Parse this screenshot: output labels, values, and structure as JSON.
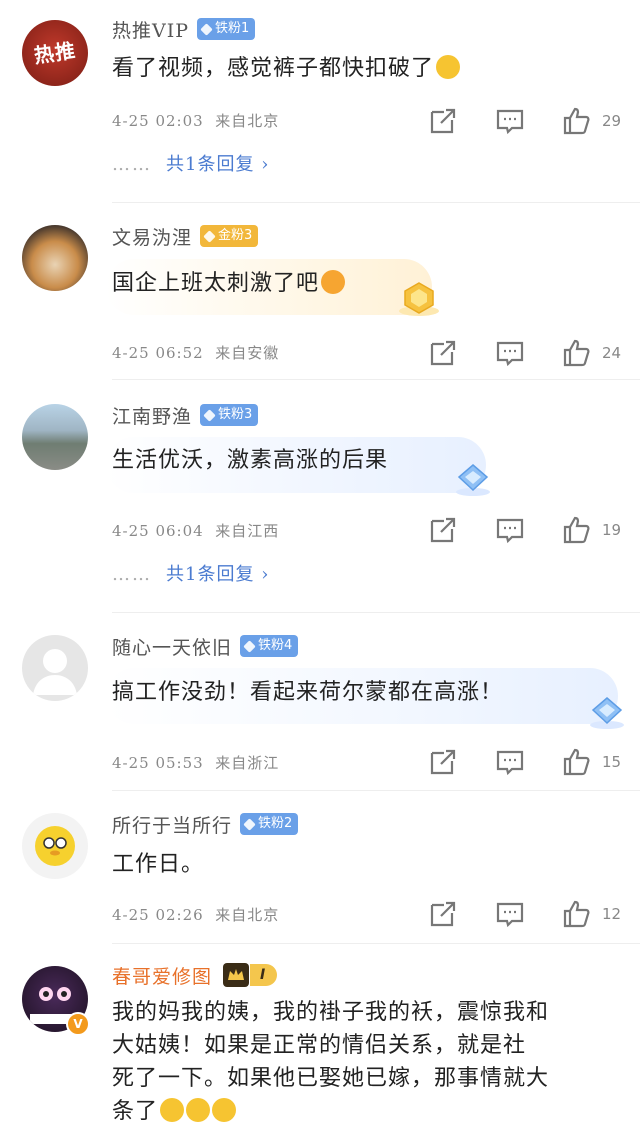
{
  "comments": [
    {
      "name": "热推VIP",
      "badge": "铁粉1",
      "text": "看了视频，感觉裤子都快扣破了",
      "time": "4-25 02:03",
      "loc": "来自北京",
      "likes": "29",
      "replies": "共1条回复",
      "avatar_text": "热推"
    },
    {
      "name": "文易沩浬",
      "badge": "金粉3",
      "text": "国企上班太刺激了吧",
      "time": "4-25 06:52",
      "loc": "来自安徽",
      "likes": "24"
    },
    {
      "name": "江南野渔",
      "badge": "铁粉3",
      "text": "生活优沃，激素高涨的后果",
      "time": "4-25 06:04",
      "loc": "来自江西",
      "likes": "19",
      "replies": "共1条回复"
    },
    {
      "name": "随心一天依旧",
      "badge": "铁粉4",
      "text": "搞工作没劲！看起来荷尔蒙都在高涨！",
      "time": "4-25 05:53",
      "loc": "来自浙江",
      "likes": "15"
    },
    {
      "name": "所行于当所行",
      "badge": "铁粉2",
      "text": "工作日。",
      "time": "4-25 02:26",
      "loc": "来自北京",
      "likes": "12"
    },
    {
      "name": "春哥爱修图",
      "badge": "I",
      "lines": [
        "我的妈我的姨，我的褂子我的袄，震惊我和",
        "大姑姨！如果是正常的情侣关系，就是社",
        "死了一下。如果他已娶她已嫁，那事情就大",
        "条了"
      ]
    }
  ],
  "reply_dots": "……",
  "reply_arrow": "›",
  "icons": {
    "share": "share-icon",
    "comment": "comment-icon",
    "like": "thumbs-up-icon",
    "badge_gem": "diamond-icon",
    "crown": "crown-icon"
  },
  "colors": {
    "iron_badge": "#6aa0e8",
    "gold_badge": "#f2b73a",
    "reply_link": "#4b7bd0",
    "orange_name": "#e8712a"
  }
}
